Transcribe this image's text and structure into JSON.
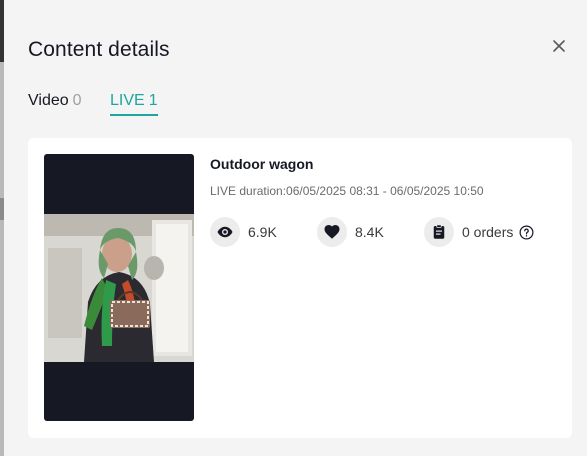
{
  "modal": {
    "title": "Content details"
  },
  "tabs": [
    {
      "label": "Video",
      "count": "0"
    },
    {
      "label": "LIVE",
      "count": "1"
    }
  ],
  "live": {
    "title": "Outdoor wagon",
    "duration": "LIVE duration:06/05/2025 08:31 - 06/05/2025 10:50",
    "stats": {
      "views": "6.9K",
      "likes": "8.4K",
      "orders": "0 orders"
    }
  },
  "icons": {
    "close": "close-icon",
    "views": "eye-icon",
    "likes": "heart-icon",
    "orders": "clipboard-icon",
    "help": "help-circle-icon"
  },
  "colors": {
    "accent": "#1ea5a0",
    "text": "#161823",
    "muted": "#a0a0a0"
  }
}
